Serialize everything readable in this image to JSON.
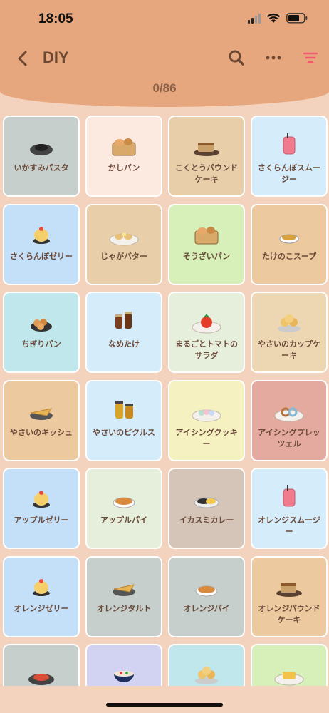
{
  "status_bar": {
    "time": "18:05"
  },
  "nav": {
    "title": "DIY",
    "back_icon": "chevron-left-icon",
    "search_icon": "search-icon",
    "more_icon": "more-horizontal-icon",
    "filter_icon": "filter-icon"
  },
  "progress": {
    "text": "0/86"
  },
  "colors": {
    "header": "#e7a77e",
    "background": "#f3d3bd",
    "filter_accent": "#ef5a6f"
  },
  "items": [
    {
      "label": "いかすみパスタ",
      "color": "#c6cfcc",
      "icon": "black-pasta-icon"
    },
    {
      "label": "かしパン",
      "color": "#fce9e0",
      "icon": "bread-basket-icon"
    },
    {
      "label": "こくとうパウンドケーキ",
      "color": "#e8cfa9",
      "icon": "pound-cake-icon"
    },
    {
      "label": "さくらんぼスムージー",
      "color": "#d5ecfb",
      "icon": "smoothie-icon"
    },
    {
      "label": "さくらんぼゼリー",
      "color": "#c4e0f9",
      "icon": "jelly-icon"
    },
    {
      "label": "じゃがバター",
      "color": "#e8cfa9",
      "icon": "potato-butter-icon"
    },
    {
      "label": "そうざいパン",
      "color": "#d7efb8",
      "icon": "bread-basket-icon"
    },
    {
      "label": "たけのこスープ",
      "color": "#edc9a0",
      "icon": "soup-icon"
    },
    {
      "label": "ちぎりパン",
      "color": "#bfe7ec",
      "icon": "pull-apart-bread-icon"
    },
    {
      "label": "なめたけ",
      "color": "#d5ecfb",
      "icon": "jars-icon"
    },
    {
      "label": "まるごとトマトのサラダ",
      "color": "#e6efdc",
      "icon": "tomato-salad-icon"
    },
    {
      "label": "やさいのカップケーキ",
      "color": "#edd7b3",
      "icon": "cupcake-icon"
    },
    {
      "label": "やさいのキッシュ",
      "color": "#edc9a0",
      "icon": "quiche-icon"
    },
    {
      "label": "やさいのピクルス",
      "color": "#d5ecfb",
      "icon": "pickles-icon"
    },
    {
      "label": "アイシングクッキー",
      "color": "#f6f1c0",
      "icon": "cookies-icon"
    },
    {
      "label": "アイシングプレッツェル",
      "color": "#e4aaa0",
      "icon": "pretzel-icon"
    },
    {
      "label": "アップルゼリー",
      "color": "#c4e0f9",
      "icon": "jelly-icon"
    },
    {
      "label": "アップルパイ",
      "color": "#e6efdc",
      "icon": "pie-icon"
    },
    {
      "label": "イカスミカレー",
      "color": "#d4c5b8",
      "icon": "curry-icon"
    },
    {
      "label": "オレンジスムージー",
      "color": "#d5ecfb",
      "icon": "smoothie-icon"
    },
    {
      "label": "オレンジゼリー",
      "color": "#c4e0f9",
      "icon": "jelly-icon"
    },
    {
      "label": "オレンジタルト",
      "color": "#c6cfcc",
      "icon": "tart-slice-icon"
    },
    {
      "label": "オレンジパイ",
      "color": "#c6cfcc",
      "icon": "pie-icon"
    },
    {
      "label": "オレンジパウンドケーキ",
      "color": "#edc9a0",
      "icon": "pound-cake-icon"
    },
    {
      "label": "",
      "color": "#c6cfcc",
      "icon": "pasta-icon"
    },
    {
      "label": "",
      "color": "#d2d3f3",
      "icon": "salad-bowl-icon"
    },
    {
      "label": "",
      "color": "#bfe7ec",
      "icon": "muffins-icon"
    },
    {
      "label": "",
      "color": "#d7efb8",
      "icon": "toast-icon"
    }
  ]
}
